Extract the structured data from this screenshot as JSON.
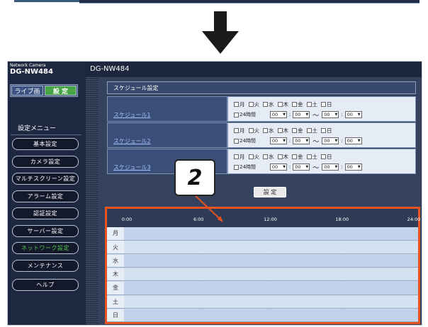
{
  "sidebar": {
    "brand_small": "Network Camera",
    "brand_model": "DG-NW484",
    "mode_live": "ライブ画",
    "mode_setup": "設 定",
    "menu_title": "設定メニュー",
    "items": [
      {
        "label": "基本設定"
      },
      {
        "label": "カメラ設定"
      },
      {
        "label": "マルチスクリーン設定"
      },
      {
        "label": "アラーム設定"
      },
      {
        "label": "認証設定"
      },
      {
        "label": "サーバー設定"
      },
      {
        "label": "ネットワーク設定",
        "active": true
      },
      {
        "label": "メンテナンス"
      },
      {
        "label": "ヘルプ"
      }
    ]
  },
  "header": {
    "title": "DG-NW484"
  },
  "schedule": {
    "title": "スケジュール設定",
    "days": [
      "月",
      "火",
      "水",
      "木",
      "金",
      "土",
      "日"
    ],
    "allday_label": "24時間",
    "tilde": "～",
    "colon": ":",
    "rows": [
      {
        "name": "スケジュール1",
        "start_h": "00",
        "start_m": "00",
        "end_h": "00",
        "end_m": "00"
      },
      {
        "name": "スケジュール2",
        "start_h": "00",
        "start_m": "00",
        "end_h": "00",
        "end_m": "00"
      },
      {
        "name": "スケジュール3",
        "start_h": "00",
        "start_m": "00",
        "end_h": "00",
        "end_m": "00"
      }
    ],
    "set_button": "設 定"
  },
  "callout": {
    "number": "2",
    "color": "#e8531f"
  },
  "timeline": {
    "ticks": [
      "0:00",
      "6:00",
      "12:00",
      "18:00",
      "24:00"
    ],
    "days": [
      "月",
      "火",
      "水",
      "木",
      "金",
      "土",
      "日"
    ]
  }
}
